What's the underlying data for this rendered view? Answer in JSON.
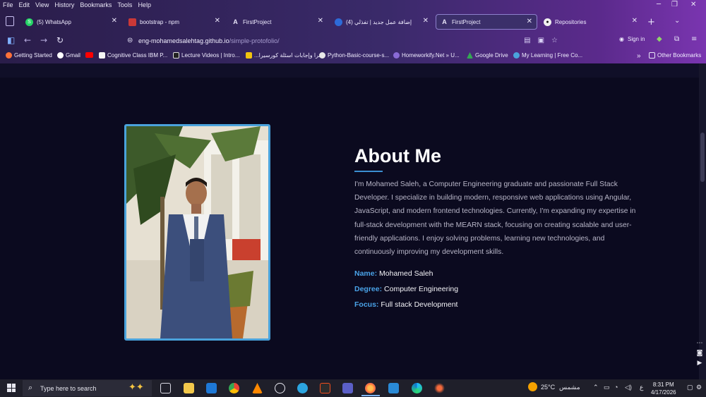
{
  "menu": [
    "File",
    "Edit",
    "View",
    "History",
    "Bookmarks",
    "Tools",
    "Help"
  ],
  "tabs": [
    {
      "label": "(5) WhatsApp",
      "icon": "whatsapp-icon",
      "color": "#25d366"
    },
    {
      "label": "bootstrap - npm",
      "icon": "npm-icon",
      "color": "#cb3837"
    },
    {
      "label": "FirstProject",
      "icon": "angular-icon",
      "color": "#2b1f44"
    },
    {
      "label": "(4) إضافة عمل جديد | تفذلي",
      "icon": "mostaql-icon",
      "color": "#2d6bd8"
    },
    {
      "label": "FirstProject",
      "icon": "angular-icon",
      "color": "#2b1f44"
    },
    {
      "label": "Repositories",
      "icon": "github-icon",
      "color": "#111111"
    }
  ],
  "url": {
    "host": "eng-mohamedsalehtag.github.io",
    "path": "/simple-protofolio/"
  },
  "signin": "Sign in",
  "bookmarks": [
    {
      "label": "Getting Started",
      "color": "#ff7139"
    },
    {
      "label": "Gmail",
      "color": "#ea4335"
    },
    {
      "label": "",
      "color": "#ff0000"
    },
    {
      "label": "Cognitive Class IBM P...",
      "color": "#f4f4f4"
    },
    {
      "label": "Lecture Videos | Intro...",
      "color": "#222222"
    },
    {
      "label": "...سرا وإجابات اسئلة كورسيرا",
      "color": "#f1c40f"
    },
    {
      "label": "Python-Basic-course-s...",
      "color": "#e8e8e8"
    },
    {
      "label": "Homeworkify.Net » U...",
      "color": "#8a6bd6"
    },
    {
      "label": "Google Drive",
      "color": "#34a853"
    },
    {
      "label": "My Learning | Free Co...",
      "color": "#4aa3dc"
    }
  ],
  "other_bookmarks": "Other Bookmarks",
  "about": {
    "title": "About Me",
    "text": "I'm Mohamed Saleh, a Computer Engineering graduate and passionate Full Stack Developer. I specialize in building modern, responsive web applications using Angular, JavaScript, and modern frontend technologies. Currently, I'm expanding my expertise in full-stack development with the MEARN stack, focusing on creating scalable and user-friendly applications. I enjoy solving problems, learning new technologies, and continuously improving my development skills.",
    "name_label": "Name:",
    "name_value": "Mohamed Saleh",
    "degree_label": "Degree:",
    "degree_value": "Computer Engineering",
    "focus_label": "Focus:",
    "focus_value": "Full stack Development"
  },
  "taskbar": {
    "search_placeholder": "Type here to search",
    "weather": "25°C",
    "weather_label": "مشمس",
    "lang": "ع",
    "time": "8:31 PM",
    "date": "4/17/2026"
  },
  "colors": {
    "accent": "#4aa3dc",
    "background": "#0b0a1f",
    "label": "#4aa3e8"
  }
}
